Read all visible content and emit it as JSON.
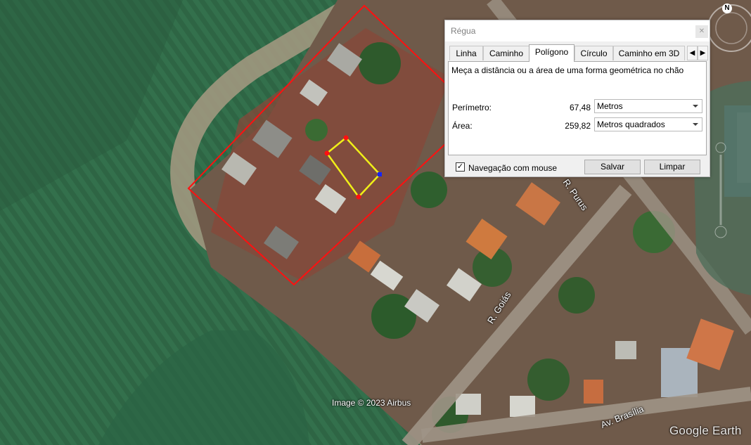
{
  "map": {
    "attribution": "Image © 2023 Airbus",
    "logo": "Google Earth",
    "streets": [
      {
        "name": "R. Goiás"
      },
      {
        "name": "Av. Brasília"
      },
      {
        "name": "R. Purus"
      }
    ],
    "compass_label": "N",
    "colors": {
      "boundary": "#ff1010",
      "polygon": "#f0ef18",
      "field": "#2f6a45",
      "soil": "#8a4a3a"
    }
  },
  "dialog": {
    "title": "Régua",
    "close_icon": "close-icon",
    "tabs": [
      "Linha",
      "Caminho",
      "Polígono",
      "Círculo",
      "Caminho em 3D"
    ],
    "active_tab": "Polígono",
    "description": "Meça a distância ou a área de uma forma geométrica no chão",
    "perimeter": {
      "label": "Perímetro:",
      "value": "67,48",
      "unit": "Metros"
    },
    "area": {
      "label": "Área:",
      "value": "259,82",
      "unit": "Metros quadrados"
    },
    "mouse_nav": {
      "label": "Navegação com mouse",
      "checked": true
    },
    "buttons": {
      "save": "Salvar",
      "clear": "Limpar"
    }
  }
}
